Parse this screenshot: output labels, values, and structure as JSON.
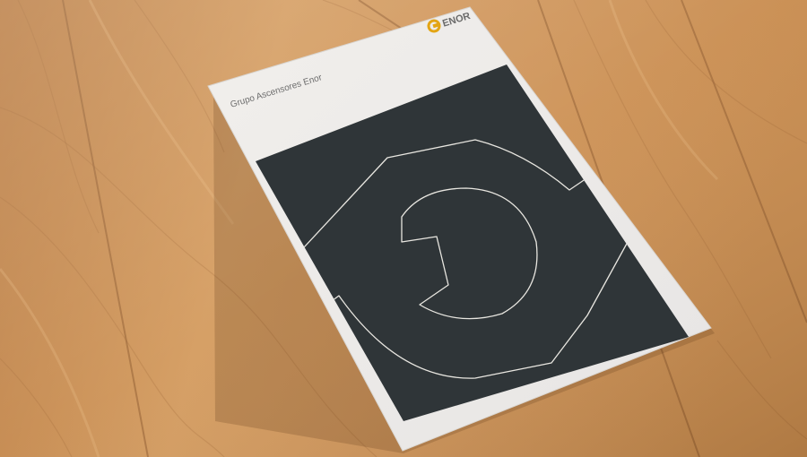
{
  "brochure": {
    "company_title": "Grupo Ascensores Enor",
    "brand_logo_text": "ENOR"
  },
  "colors": {
    "wood_light": "#dca56a",
    "wood_mid": "#c8894a",
    "wood_dark": "#a86a33",
    "paper": "#f4f3f1",
    "cover_panel": "#2f3538",
    "logo_yellow": "#e3a515",
    "outline_line": "#e8e6e0"
  },
  "icons": {
    "logo_mark": "enor-logo-icon",
    "cover_graphic": "wrench-outline-icon"
  }
}
